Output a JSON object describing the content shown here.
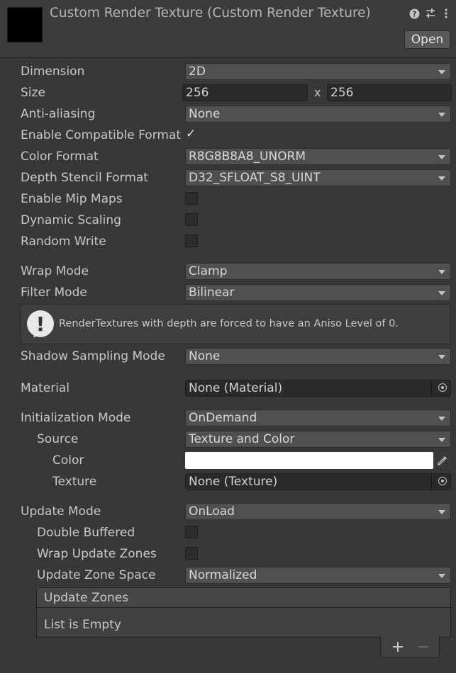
{
  "header": {
    "title": "Custom Render Texture (Custom Render Texture)",
    "open_label": "Open",
    "icons": [
      "help-icon",
      "preset-icon",
      "kebab-menu-icon"
    ]
  },
  "fields": {
    "dimension": {
      "label": "Dimension",
      "value": "2D"
    },
    "size": {
      "label": "Size",
      "width": "256",
      "separator": "x",
      "height": "256"
    },
    "anti_aliasing": {
      "label": "Anti-aliasing",
      "value": "None"
    },
    "enable_compatible_format": {
      "label": "Enable Compatible Format",
      "checked": true
    },
    "color_format": {
      "label": "Color Format",
      "value": "R8G8B8A8_UNORM"
    },
    "depth_stencil_format": {
      "label": "Depth Stencil Format",
      "value": "D32_SFLOAT_S8_UINT"
    },
    "enable_mip_maps": {
      "label": "Enable Mip Maps",
      "checked": false
    },
    "dynamic_scaling": {
      "label": "Dynamic Scaling",
      "checked": false
    },
    "random_write": {
      "label": "Random Write",
      "checked": false
    },
    "wrap_mode": {
      "label": "Wrap Mode",
      "value": "Clamp"
    },
    "filter_mode": {
      "label": "Filter Mode",
      "value": "Bilinear"
    },
    "help_message": "RenderTextures with depth are forced to have an Aniso Level of 0.",
    "shadow_sampling_mode": {
      "label": "Shadow Sampling Mode",
      "value": "None"
    },
    "material": {
      "label": "Material",
      "value": "None (Material)"
    },
    "initialization_mode": {
      "label": "Initialization Mode",
      "value": "OnDemand"
    },
    "source": {
      "label": "Source",
      "value": "Texture and Color"
    },
    "color": {
      "label": "Color",
      "value": "#ffffff"
    },
    "texture": {
      "label": "Texture",
      "value": "None (Texture)"
    },
    "update_mode": {
      "label": "Update Mode",
      "value": "OnLoad"
    },
    "double_buffered": {
      "label": "Double Buffered",
      "checked": false
    },
    "wrap_update_zones": {
      "label": "Wrap Update Zones",
      "checked": false
    },
    "update_zone_space": {
      "label": "Update Zone Space",
      "value": "Normalized"
    }
  },
  "update_zones": {
    "title": "Update Zones",
    "empty_text": "List is Empty",
    "add_label": "+",
    "remove_label": "−"
  },
  "colors": {
    "background": "#383838",
    "text": "#c8c8c8",
    "dropdown": "#505050",
    "field": "#2a2a2a"
  }
}
